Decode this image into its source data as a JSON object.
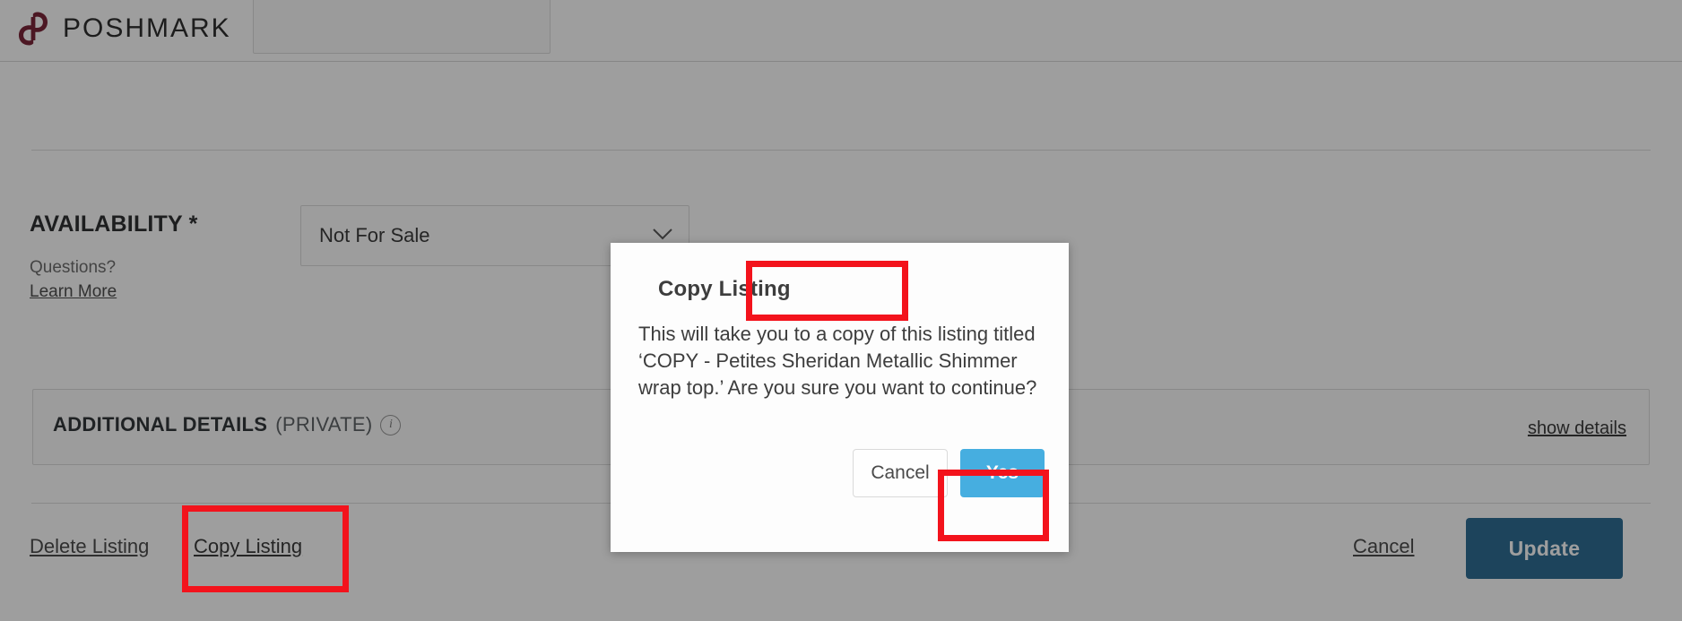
{
  "header": {
    "brand_name": "POSHMARK",
    "brand_icon": "poshmark-p-logo-icon",
    "brand_color": "#7b2639"
  },
  "form": {
    "availability": {
      "label": "AVAILABILITY *",
      "questions_text": "Questions?",
      "learn_more_label": "Learn More",
      "select_value": "Not For Sale",
      "chevron_icon": "chevron-down-icon"
    },
    "additional_details": {
      "title": "ADDITIONAL DETAILS",
      "subtitle": "(PRIVATE)",
      "info_icon": "info-circle-icon",
      "info_glyph": "i",
      "show_details_label": "show details"
    }
  },
  "actions": {
    "delete_listing_label": "Delete Listing",
    "copy_listing_label": "Copy Listing",
    "cancel_label": "Cancel",
    "update_label": "Update",
    "update_color": "#2f6f95"
  },
  "modal": {
    "title": "Copy Listing",
    "body": "This will take you to a copy of this listing titled ‘COPY - Petites Sheridan Metallic Shimmer wrap top.’ Are you sure you want to continue?",
    "cancel_label": "Cancel",
    "confirm_label": "Yes",
    "confirm_color": "#46aee0"
  },
  "annotations": {
    "highlight_color": "#f3131c",
    "boxes": [
      {
        "name": "modal-title-highlight",
        "target": "Copy Listing"
      },
      {
        "name": "modal-yes-highlight",
        "target": "Yes"
      },
      {
        "name": "copy-listing-link-highlight",
        "target": "Copy Listing"
      }
    ]
  }
}
